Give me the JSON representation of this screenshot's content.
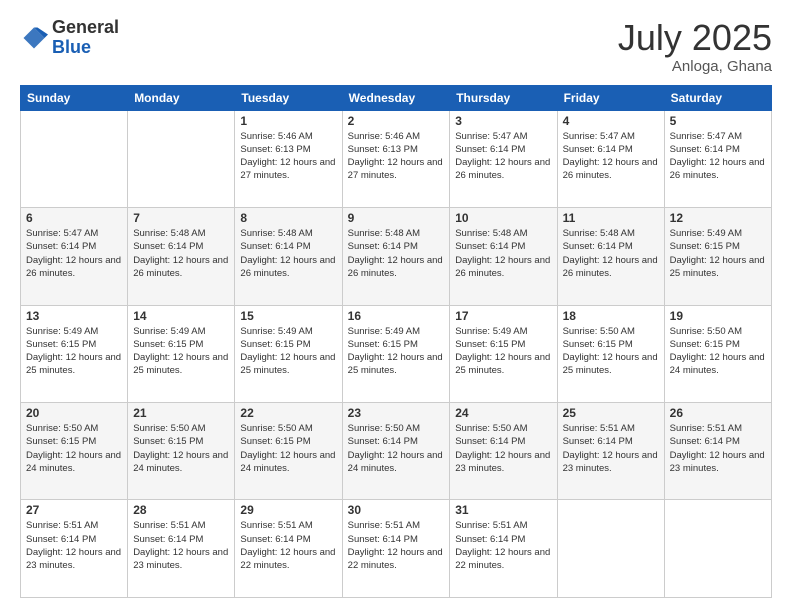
{
  "header": {
    "logo": {
      "general": "General",
      "blue": "Blue"
    },
    "title": "July 2025",
    "location": "Anloga, Ghana"
  },
  "weekdays": [
    "Sunday",
    "Monday",
    "Tuesday",
    "Wednesday",
    "Thursday",
    "Friday",
    "Saturday"
  ],
  "weeks": [
    [
      {
        "day": "",
        "info": ""
      },
      {
        "day": "",
        "info": ""
      },
      {
        "day": "1",
        "info": "Sunrise: 5:46 AM\nSunset: 6:13 PM\nDaylight: 12 hours and 27 minutes."
      },
      {
        "day": "2",
        "info": "Sunrise: 5:46 AM\nSunset: 6:13 PM\nDaylight: 12 hours and 27 minutes."
      },
      {
        "day": "3",
        "info": "Sunrise: 5:47 AM\nSunset: 6:14 PM\nDaylight: 12 hours and 26 minutes."
      },
      {
        "day": "4",
        "info": "Sunrise: 5:47 AM\nSunset: 6:14 PM\nDaylight: 12 hours and 26 minutes."
      },
      {
        "day": "5",
        "info": "Sunrise: 5:47 AM\nSunset: 6:14 PM\nDaylight: 12 hours and 26 minutes."
      }
    ],
    [
      {
        "day": "6",
        "info": "Sunrise: 5:47 AM\nSunset: 6:14 PM\nDaylight: 12 hours and 26 minutes."
      },
      {
        "day": "7",
        "info": "Sunrise: 5:48 AM\nSunset: 6:14 PM\nDaylight: 12 hours and 26 minutes."
      },
      {
        "day": "8",
        "info": "Sunrise: 5:48 AM\nSunset: 6:14 PM\nDaylight: 12 hours and 26 minutes."
      },
      {
        "day": "9",
        "info": "Sunrise: 5:48 AM\nSunset: 6:14 PM\nDaylight: 12 hours and 26 minutes."
      },
      {
        "day": "10",
        "info": "Sunrise: 5:48 AM\nSunset: 6:14 PM\nDaylight: 12 hours and 26 minutes."
      },
      {
        "day": "11",
        "info": "Sunrise: 5:48 AM\nSunset: 6:14 PM\nDaylight: 12 hours and 26 minutes."
      },
      {
        "day": "12",
        "info": "Sunrise: 5:49 AM\nSunset: 6:15 PM\nDaylight: 12 hours and 25 minutes."
      }
    ],
    [
      {
        "day": "13",
        "info": "Sunrise: 5:49 AM\nSunset: 6:15 PM\nDaylight: 12 hours and 25 minutes."
      },
      {
        "day": "14",
        "info": "Sunrise: 5:49 AM\nSunset: 6:15 PM\nDaylight: 12 hours and 25 minutes."
      },
      {
        "day": "15",
        "info": "Sunrise: 5:49 AM\nSunset: 6:15 PM\nDaylight: 12 hours and 25 minutes."
      },
      {
        "day": "16",
        "info": "Sunrise: 5:49 AM\nSunset: 6:15 PM\nDaylight: 12 hours and 25 minutes."
      },
      {
        "day": "17",
        "info": "Sunrise: 5:49 AM\nSunset: 6:15 PM\nDaylight: 12 hours and 25 minutes."
      },
      {
        "day": "18",
        "info": "Sunrise: 5:50 AM\nSunset: 6:15 PM\nDaylight: 12 hours and 25 minutes."
      },
      {
        "day": "19",
        "info": "Sunrise: 5:50 AM\nSunset: 6:15 PM\nDaylight: 12 hours and 24 minutes."
      }
    ],
    [
      {
        "day": "20",
        "info": "Sunrise: 5:50 AM\nSunset: 6:15 PM\nDaylight: 12 hours and 24 minutes."
      },
      {
        "day": "21",
        "info": "Sunrise: 5:50 AM\nSunset: 6:15 PM\nDaylight: 12 hours and 24 minutes."
      },
      {
        "day": "22",
        "info": "Sunrise: 5:50 AM\nSunset: 6:15 PM\nDaylight: 12 hours and 24 minutes."
      },
      {
        "day": "23",
        "info": "Sunrise: 5:50 AM\nSunset: 6:14 PM\nDaylight: 12 hours and 24 minutes."
      },
      {
        "day": "24",
        "info": "Sunrise: 5:50 AM\nSunset: 6:14 PM\nDaylight: 12 hours and 23 minutes."
      },
      {
        "day": "25",
        "info": "Sunrise: 5:51 AM\nSunset: 6:14 PM\nDaylight: 12 hours and 23 minutes."
      },
      {
        "day": "26",
        "info": "Sunrise: 5:51 AM\nSunset: 6:14 PM\nDaylight: 12 hours and 23 minutes."
      }
    ],
    [
      {
        "day": "27",
        "info": "Sunrise: 5:51 AM\nSunset: 6:14 PM\nDaylight: 12 hours and 23 minutes."
      },
      {
        "day": "28",
        "info": "Sunrise: 5:51 AM\nSunset: 6:14 PM\nDaylight: 12 hours and 23 minutes."
      },
      {
        "day": "29",
        "info": "Sunrise: 5:51 AM\nSunset: 6:14 PM\nDaylight: 12 hours and 22 minutes."
      },
      {
        "day": "30",
        "info": "Sunrise: 5:51 AM\nSunset: 6:14 PM\nDaylight: 12 hours and 22 minutes."
      },
      {
        "day": "31",
        "info": "Sunrise: 5:51 AM\nSunset: 6:14 PM\nDaylight: 12 hours and 22 minutes."
      },
      {
        "day": "",
        "info": ""
      },
      {
        "day": "",
        "info": ""
      }
    ]
  ]
}
